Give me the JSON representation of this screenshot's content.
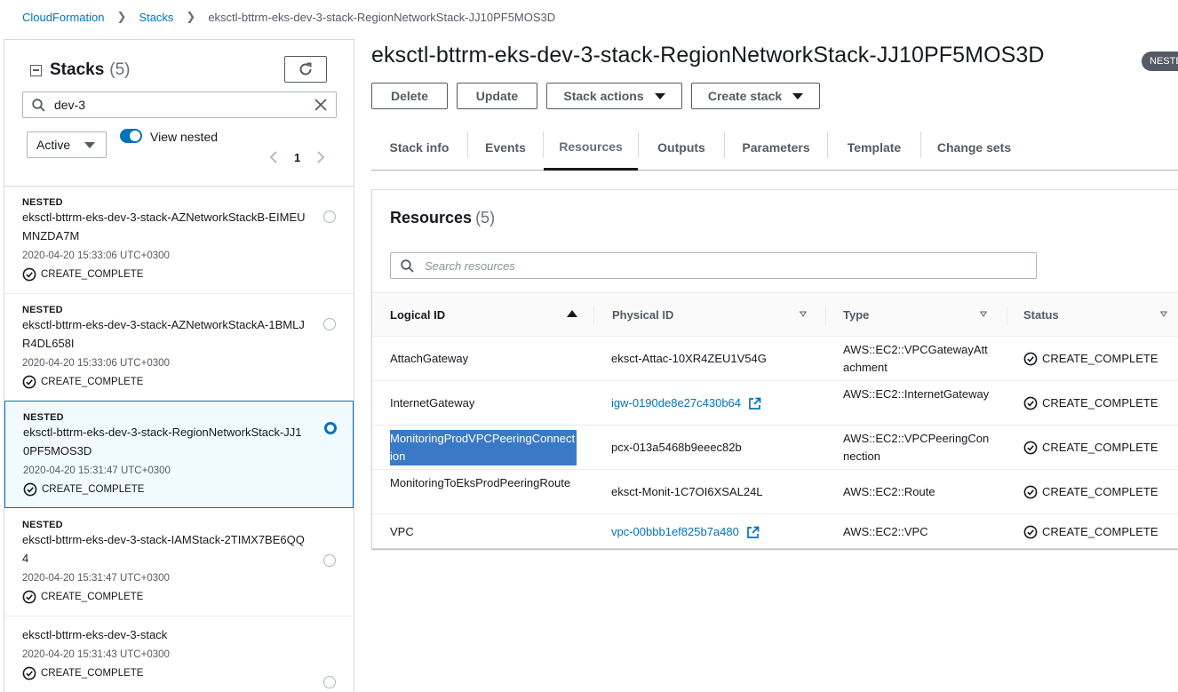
{
  "breadcrumb": {
    "items": [
      "CloudFormation",
      "Stacks"
    ],
    "current": "eksctl-bttrm-eks-dev-3-stack-RegionNetworkStack-JJ10PF5MOS3D"
  },
  "sidebar": {
    "title": "Stacks",
    "count": "(5)",
    "search_value": "dev-3",
    "filter_selected": "Active",
    "view_nested_label": "View nested",
    "page_number": "1",
    "stacks": [
      {
        "nested": "NESTED",
        "name": "eksctl-bttrm-eks-dev-3-stack-AZNetworkStackB-EIMEUMNZDA7M",
        "date": "2020-04-20 15:33:06 UTC+0300",
        "status": "CREATE_COMPLETE",
        "selected": false
      },
      {
        "nested": "NESTED",
        "name": "eksctl-bttrm-eks-dev-3-stack-AZNetworkStackA-1BMLJR4DL658I",
        "date": "2020-04-20 15:33:06 UTC+0300",
        "status": "CREATE_COMPLETE",
        "selected": false
      },
      {
        "nested": "NESTED",
        "name": "eksctl-bttrm-eks-dev-3-stack-RegionNetworkStack-JJ10PF5MOS3D",
        "date": "2020-04-20 15:31:47 UTC+0300",
        "status": "CREATE_COMPLETE",
        "selected": true
      },
      {
        "nested": "NESTED",
        "name": "eksctl-bttrm-eks-dev-3-stack-IAMStack-2TIMX7BE6QQ4",
        "date": "2020-04-20 15:31:47 UTC+0300",
        "status": "CREATE_COMPLETE",
        "selected": false
      },
      {
        "nested": "",
        "name": "eksctl-bttrm-eks-dev-3-stack",
        "date": "2020-04-20 15:31:43 UTC+0300",
        "status": "CREATE_COMPLETE",
        "selected": false
      }
    ]
  },
  "main": {
    "title": "eksctl-bttrm-eks-dev-3-stack-RegionNetworkStack-JJ10PF5MOS3D",
    "badge": "NESTE",
    "buttons": {
      "delete": "Delete",
      "update": "Update",
      "stack_actions": "Stack actions",
      "create_stack": "Create stack"
    },
    "tabs": [
      "Stack info",
      "Events",
      "Resources",
      "Outputs",
      "Parameters",
      "Template",
      "Change sets"
    ],
    "active_tab": "Resources",
    "resources": {
      "title": "Resources",
      "count": "(5)",
      "search_placeholder": "Search resources",
      "columns": [
        "Logical ID",
        "Physical ID",
        "Type",
        "Status"
      ],
      "rows": [
        {
          "logical_id": "AttachGateway",
          "physical_id": "eksct-Attac-10XR4ZEU1V54G",
          "type": "AWS::EC2::VPCGatewayAttachment",
          "status": "CREATE_COMPLETE",
          "link": false
        },
        {
          "logical_id": "InternetGateway",
          "physical_id": "igw-0190de8e27c430b64",
          "type": "AWS::EC2::InternetGateway",
          "status": "CREATE_COMPLETE",
          "link": true
        },
        {
          "logical_id": "MonitoringProdVPCPeeringConnection",
          "physical_id": "pcx-013a5468b9eeec82b",
          "type": "AWS::EC2::VPCPeeringConnection",
          "status": "CREATE_COMPLETE",
          "link": false
        },
        {
          "logical_id": "MonitoringToEksProdPeeringRoute",
          "physical_id": "eksct-Monit-1C7OI6XSAL24L",
          "type": "AWS::EC2::Route",
          "status": "CREATE_COMPLETE",
          "link": false
        },
        {
          "logical_id": "VPC",
          "physical_id": "vpc-00bbb1ef825b7a480",
          "type": "AWS::EC2::VPC",
          "status": "CREATE_COMPLETE",
          "link": true
        }
      ]
    }
  },
  "colors": {
    "link": "#0073bb",
    "text": "#16191f",
    "muted": "#545b64",
    "selection_highlight": "#3a79c6",
    "badge_bg": "#545b64"
  }
}
